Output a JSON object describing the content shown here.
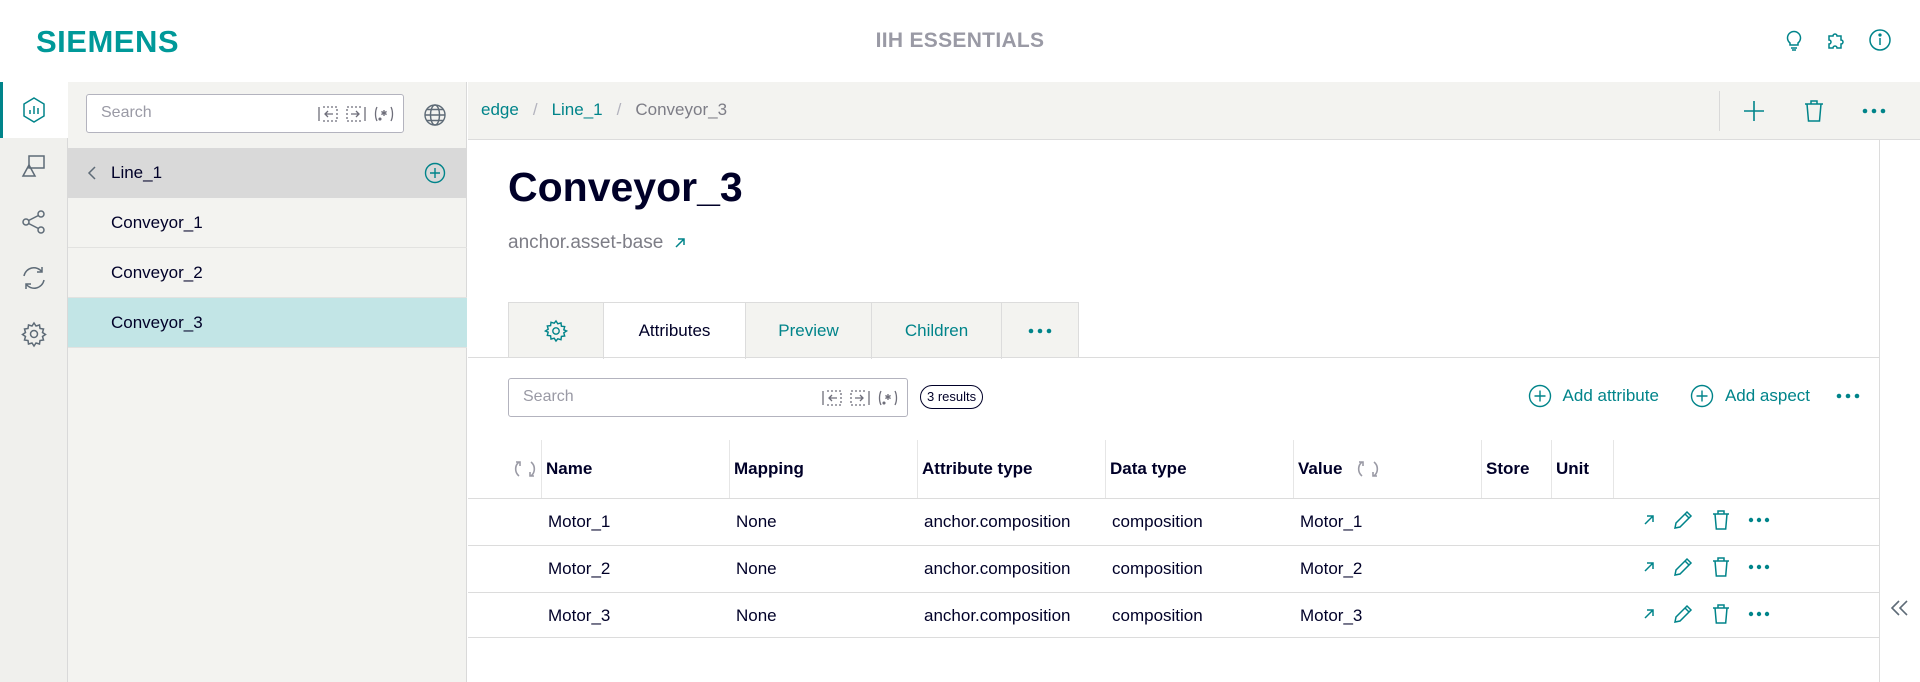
{
  "header": {
    "logo": "SIEMENS",
    "app_title": "IIH ESSENTIALS",
    "icons": [
      "lightbulb-icon",
      "puzzle-icon",
      "info-icon"
    ]
  },
  "rail": {
    "items": [
      "asset-model-icon",
      "shapes-icon",
      "connections-icon",
      "sync-icon",
      "settings-icon"
    ],
    "active_index": 0
  },
  "tree": {
    "search_placeholder": "Search",
    "parent": "Line_1",
    "items": [
      {
        "label": "Conveyor_1",
        "selected": false
      },
      {
        "label": "Conveyor_2",
        "selected": false
      },
      {
        "label": "Conveyor_3",
        "selected": true
      }
    ]
  },
  "breadcrumb": {
    "items": [
      "edge",
      "Line_1"
    ],
    "current": "Conveyor_3"
  },
  "page": {
    "title": "Conveyor_3",
    "type_link": "anchor.asset-base"
  },
  "tabs": [
    {
      "label": "",
      "icon": "gear-icon",
      "active": false
    },
    {
      "label": "Attributes",
      "active": true
    },
    {
      "label": "Preview",
      "active": false
    },
    {
      "label": "Children",
      "active": false
    },
    {
      "label": "",
      "icon": "more-icon",
      "active": false
    }
  ],
  "attributes": {
    "search_placeholder": "Search",
    "results": "3 results",
    "add_attribute": "Add attribute",
    "add_aspect": "Add aspect",
    "columns": [
      "Name",
      "Mapping",
      "Attribute type",
      "Data type",
      "Value",
      "Store",
      "Unit"
    ],
    "rows": [
      {
        "name": "Motor_1",
        "mapping": "None",
        "attribute_type": "anchor.composition",
        "data_type": "composition",
        "value": "Motor_1",
        "store": "",
        "unit": ""
      },
      {
        "name": "Motor_2",
        "mapping": "None",
        "attribute_type": "anchor.composition",
        "data_type": "composition",
        "value": "Motor_2",
        "store": "",
        "unit": ""
      },
      {
        "name": "Motor_3",
        "mapping": "None",
        "attribute_type": "anchor.composition",
        "data_type": "composition",
        "value": "Motor_3",
        "store": "",
        "unit": ""
      }
    ]
  },
  "colors": {
    "brand": "#009999",
    "accent": "#00848a",
    "selected": "#c2e5e6",
    "text": "#000028"
  }
}
